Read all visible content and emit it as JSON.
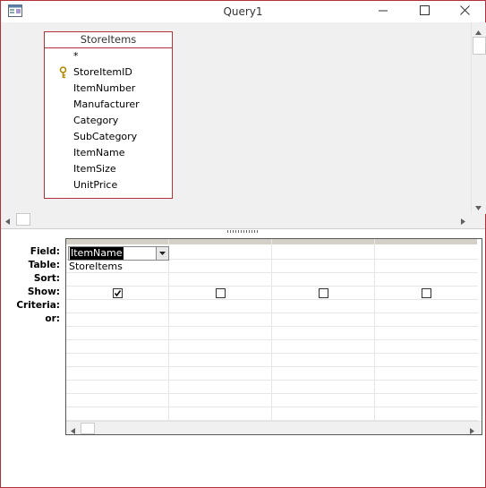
{
  "window": {
    "title": "Query1",
    "app_icon": "query-design-icon",
    "controls": [
      "minimize-icon",
      "maximize-icon",
      "close-icon"
    ]
  },
  "table": {
    "name": "StoreItems",
    "fields": [
      {
        "name": "*",
        "key": false
      },
      {
        "name": "StoreItemID",
        "key": true
      },
      {
        "name": "ItemNumber",
        "key": false
      },
      {
        "name": "Manufacturer",
        "key": false
      },
      {
        "name": "Category",
        "key": false
      },
      {
        "name": "SubCategory",
        "key": false
      },
      {
        "name": "ItemName",
        "key": false
      },
      {
        "name": "ItemSize",
        "key": false
      },
      {
        "name": "UnitPrice",
        "key": false
      }
    ]
  },
  "grid": {
    "row_labels": [
      "Field:",
      "Table:",
      "Sort:",
      "Show:",
      "Criteria:",
      "or:"
    ],
    "columns": [
      {
        "field": "ItemName",
        "table": "StoreItems",
        "show": true
      },
      {
        "field": "",
        "table": "",
        "show": false
      },
      {
        "field": "",
        "table": "",
        "show": false
      },
      {
        "field": "",
        "table": "",
        "show": false
      }
    ]
  },
  "colors": {
    "accent_border": "#b3313a",
    "selected_field_bg": "#000000"
  }
}
